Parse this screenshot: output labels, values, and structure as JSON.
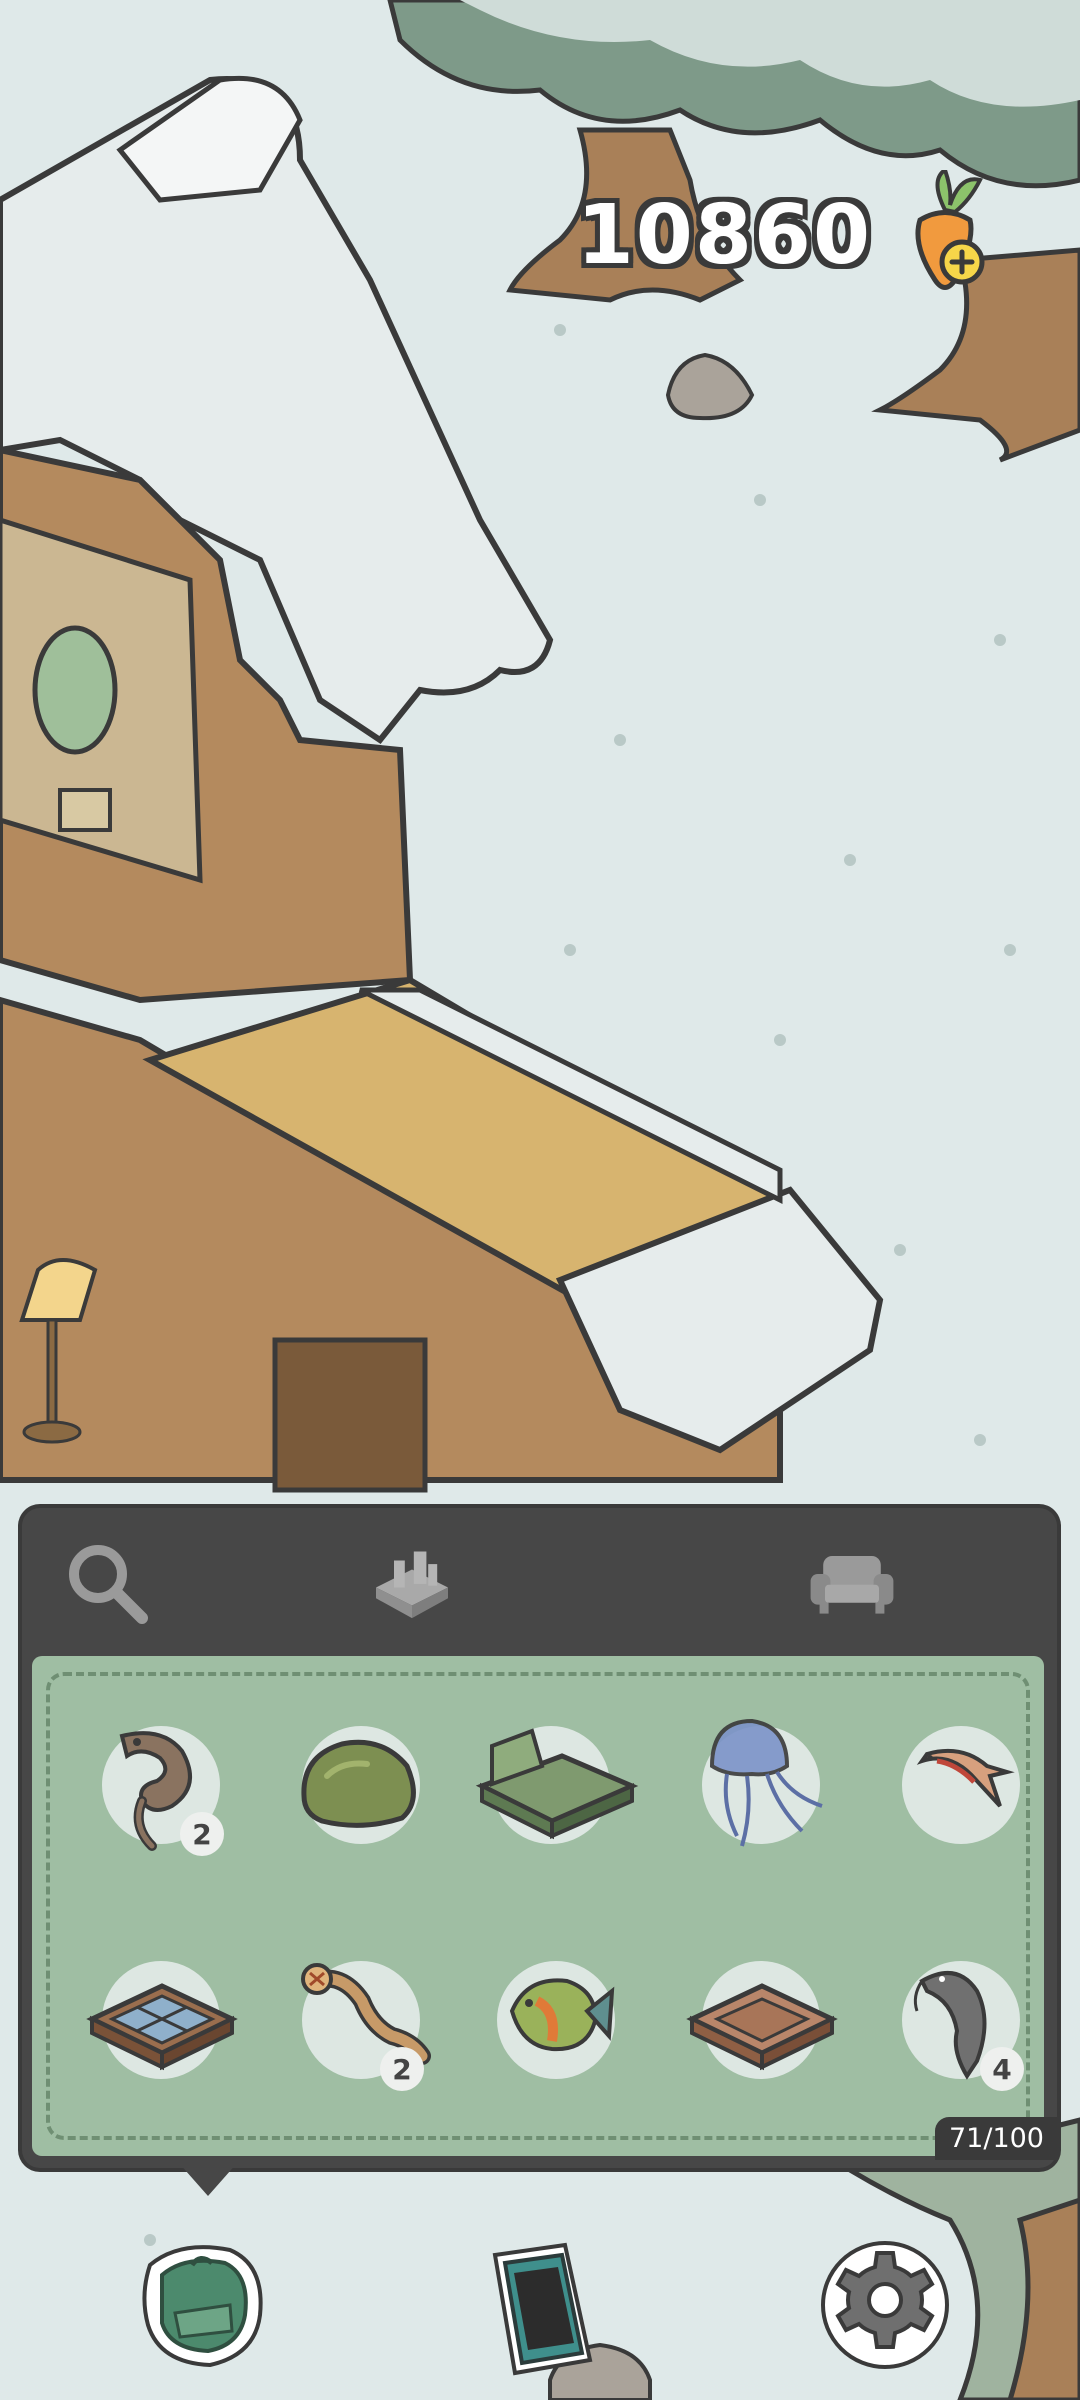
{
  "hud": {
    "currency_value": "10860",
    "currency_icon": "carrot-plus-icon"
  },
  "inventory": {
    "tabs": [
      {
        "icon": "search-icon",
        "active": false
      },
      {
        "icon": "fish-tank-icon",
        "active": true
      },
      {
        "icon": "sofa-icon",
        "active": false
      }
    ],
    "items": [
      {
        "icon": "eel-icon",
        "count": "2"
      },
      {
        "icon": "green-rock-icon",
        "count": ""
      },
      {
        "icon": "green-lounge-chair-icon",
        "count": ""
      },
      {
        "icon": "jellyfish-icon",
        "count": ""
      },
      {
        "icon": "small-fish-icon",
        "count": ""
      },
      {
        "icon": "glass-floor-tile-icon",
        "count": ""
      },
      {
        "icon": "spotted-eel-icon",
        "count": "2"
      },
      {
        "icon": "bluegill-fish-icon",
        "count": ""
      },
      {
        "icon": "wooden-crate-icon",
        "count": ""
      },
      {
        "icon": "catfish-icon",
        "count": "4"
      }
    ],
    "capacity": "71/100"
  },
  "bottom_bar": [
    {
      "icon": "backpack-icon"
    },
    {
      "icon": "phone-icon"
    },
    {
      "icon": "gear-icon"
    }
  ],
  "colors": {
    "panel": "#474747",
    "grid_bg": "#9fbea3",
    "snow": "#dfe9e9"
  }
}
